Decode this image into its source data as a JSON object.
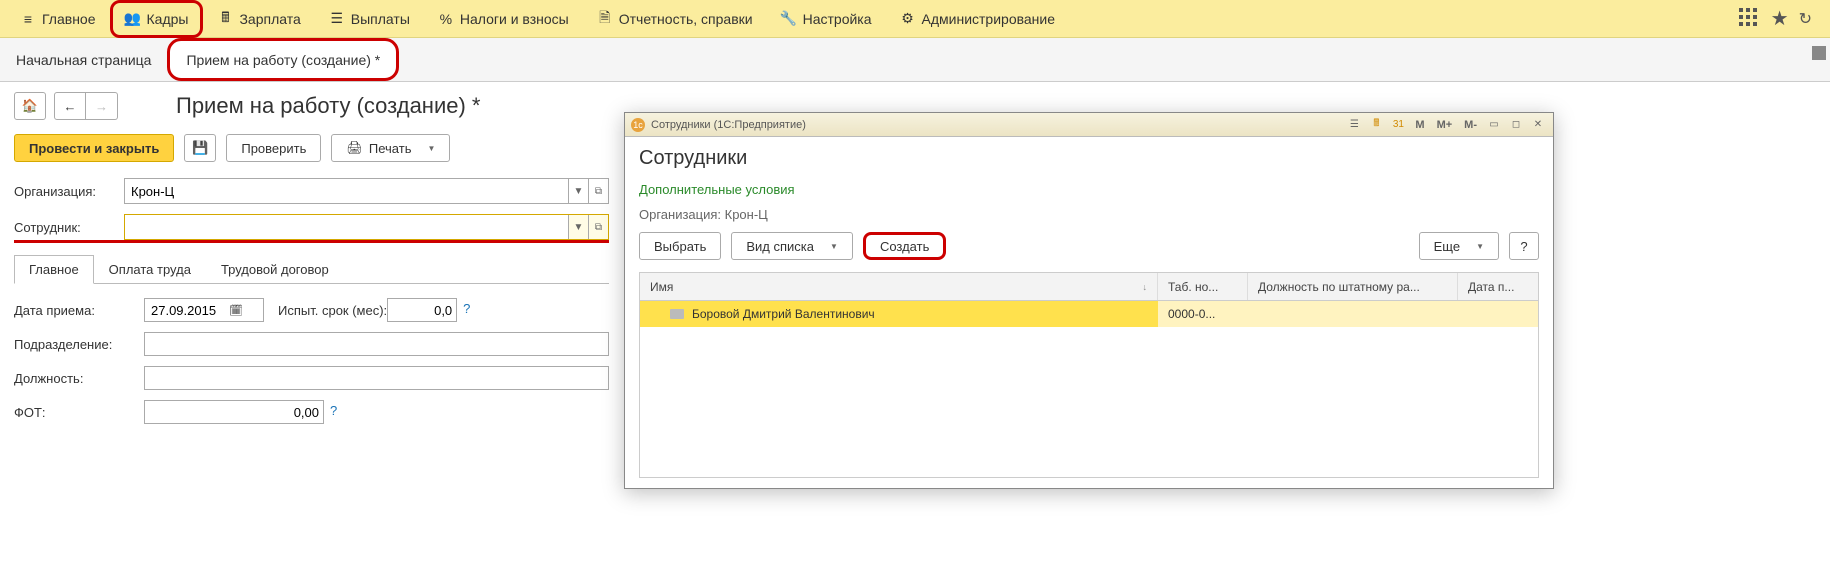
{
  "topmenu": {
    "main": "Главное",
    "kadry": "Кадры",
    "zarplata": "Зарплата",
    "vyplaty": "Выплаты",
    "nalogi": "Налоги и взносы",
    "otchet": "Отчетность, справки",
    "nastroika": "Настройка",
    "admin": "Администрирование"
  },
  "crumbs": {
    "home": "Начальная страница",
    "current": "Прием на работу (создание) *"
  },
  "page": {
    "title": "Прием на работу (создание) *",
    "post_close": "Провести и закрыть",
    "check": "Проверить",
    "print": "Печать"
  },
  "form": {
    "org_label": "Организация:",
    "org_value": "Крон-Ц",
    "emp_label": "Сотрудник:",
    "emp_value": ""
  },
  "tabs": {
    "main": "Главное",
    "pay": "Оплата труда",
    "contract": "Трудовой договор"
  },
  "fields": {
    "date_label": "Дата приема:",
    "date_value": "27.09.2015",
    "probation_label": "Испыт. срок (мес):",
    "probation_value": "0,0",
    "dept_label": "Подразделение:",
    "position_label": "Должность:",
    "fot_label": "ФОТ:",
    "fot_value": "0,00"
  },
  "modal": {
    "wintitle": "Сотрудники  (1С:Предприятие)",
    "title": "Сотрудники",
    "extra_link": "Дополнительные условия",
    "org_line": "Организация: Крон-Ц",
    "select": "Выбрать",
    "listview": "Вид списка",
    "create": "Создать",
    "more": "Еще",
    "help": "?",
    "cols": {
      "name": "Имя",
      "tab": "Таб. но...",
      "pos": "Должность по штатному ра...",
      "date": "Дата п..."
    },
    "row": {
      "name": "Боровой Дмитрий Валентинович",
      "tab": "0000-0..."
    },
    "tb": {
      "m": "M",
      "mplus": "M+",
      "mminus": "M-"
    }
  }
}
